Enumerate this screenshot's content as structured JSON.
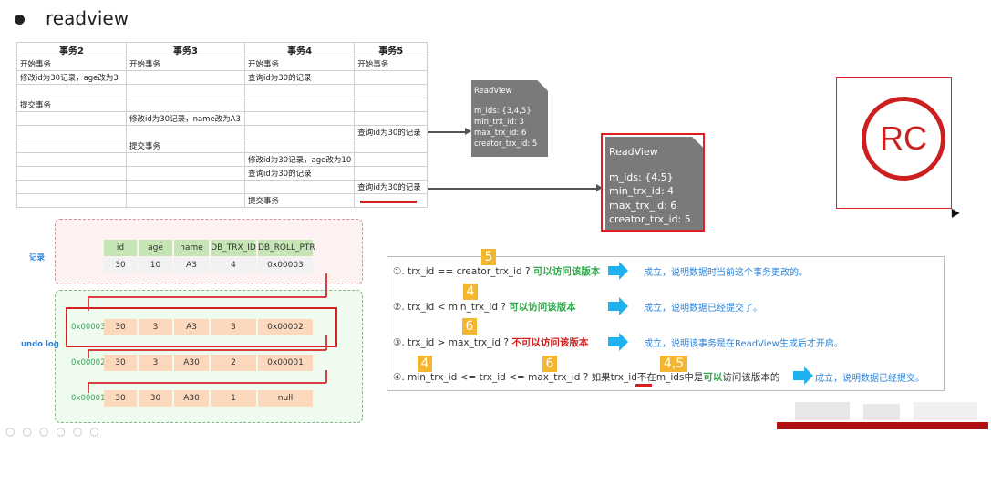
{
  "title": "readview",
  "tx_table": {
    "headers": [
      "事务2",
      "事务3",
      "事务4",
      "事务5"
    ],
    "rows": [
      [
        "开始事务",
        "开始事务",
        "开始事务",
        "开始事务"
      ],
      [
        "修改id为30记录，age改为3",
        "",
        "查询id为30的记录",
        ""
      ],
      [
        "",
        "",
        "",
        ""
      ],
      [
        "提交事务",
        "",
        "",
        ""
      ],
      [
        "",
        "修改id为30记录，name改为A3",
        "",
        ""
      ],
      [
        "",
        "",
        "",
        "查询id为30的记录"
      ],
      [
        "",
        "提交事务",
        "",
        ""
      ],
      [
        "",
        "",
        "修改id为30记录，age改为10",
        ""
      ],
      [
        "",
        "",
        "查询id为30的记录",
        ""
      ],
      [
        "",
        "",
        "",
        "查询id为30的记录"
      ],
      [
        "",
        "",
        "提交事务",
        ""
      ]
    ]
  },
  "readview1": {
    "title": "ReadView",
    "m_ids": "m_ids: {3,4,5}",
    "min": "min_trx_id: 3",
    "max": "max_trx_id: 6",
    "creator": "creator_trx_id: 5"
  },
  "readview2": {
    "title": "ReadView",
    "m_ids": "m_ids: {4,5}",
    "min": "min_trx_id: 4",
    "max": "max_trx_id: 6",
    "creator": "creator_trx_id: 5"
  },
  "rc": "RC",
  "record": {
    "label": "记录",
    "headers": [
      "id",
      "age",
      "name",
      "DB_TRX_ID",
      "DB_ROLL_PTR"
    ],
    "values": [
      "30",
      "10",
      "A3",
      "4",
      "0x00003"
    ]
  },
  "undo": {
    "label": "undo log",
    "rows": [
      {
        "addr": "0x00003",
        "values": [
          "30",
          "3",
          "A3",
          "3",
          "0x00002"
        ]
      },
      {
        "addr": "0x00002",
        "values": [
          "30",
          "3",
          "A30",
          "2",
          "0x00001"
        ]
      },
      {
        "addr": "0x00001",
        "values": [
          "30",
          "30",
          "A30",
          "1",
          "null"
        ]
      }
    ]
  },
  "conditions": [
    {
      "num": "①. ",
      "expr": "trx_id  == creator_trx_id ? ",
      "tag": "可以访问该版本",
      "result": "成立，说明数据时当前这个事务更改的。",
      "badge": "5"
    },
    {
      "num": "②. ",
      "expr": "trx_id < min_trx_id ? ",
      "tag": "可以访问该版本",
      "result": "成立，说明数据已经提交了。",
      "badge": "4"
    },
    {
      "num": "③. ",
      "expr": "trx_id > max_trx_id ? ",
      "tag": "不可以访问该版本",
      "result": "成立，说明该事务是在ReadView生成后才开启。",
      "badge": "6"
    },
    {
      "num": "④. ",
      "expr": "min_trx_id <= trx_id <= max_trx_id ? 如果trx_id不在m_ids中是",
      "tag": "可以",
      "tail": "访问该版本的",
      "result": "成立，说明数据已经提交。",
      "badge": "4",
      "badge2": "6",
      "badge3": "4,5"
    }
  ],
  "colors": {
    "accent_red": "#d62020",
    "badge": "#f2b630",
    "arrow": "#1fb0f0",
    "result": "#2a82d8",
    "green": "#2ea84a"
  }
}
